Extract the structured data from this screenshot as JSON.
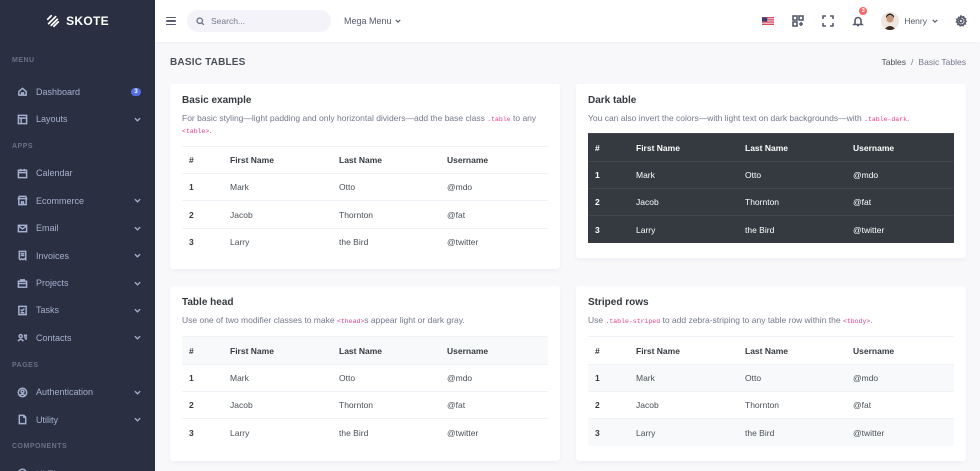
{
  "brand": {
    "name": "SKOTE"
  },
  "sidebar": {
    "sections": [
      {
        "title": "MENU",
        "items": [
          {
            "label": "Dashboard",
            "icon": "home-icon",
            "badge": "3"
          },
          {
            "label": "Layouts",
            "icon": "layout-icon",
            "chevron": true
          }
        ]
      },
      {
        "title": "APPS",
        "items": [
          {
            "label": "Calendar",
            "icon": "calendar-icon"
          },
          {
            "label": "Ecommerce",
            "icon": "store-icon",
            "chevron": true
          },
          {
            "label": "Email",
            "icon": "envelope-icon",
            "chevron": true
          },
          {
            "label": "Invoices",
            "icon": "receipt-icon",
            "chevron": true
          },
          {
            "label": "Projects",
            "icon": "briefcase-icon",
            "chevron": true
          },
          {
            "label": "Tasks",
            "icon": "task-icon",
            "chevron": true
          },
          {
            "label": "Contacts",
            "icon": "contacts-icon",
            "chevron": true
          }
        ]
      },
      {
        "title": "PAGES",
        "items": [
          {
            "label": "Authentication",
            "icon": "user-circle-icon",
            "chevron": true
          },
          {
            "label": "Utility",
            "icon": "file-icon",
            "chevron": true
          }
        ]
      },
      {
        "title": "COMPONENTS",
        "items": [
          {
            "label": "UI Elements",
            "icon": "tune-icon",
            "chevron": true
          }
        ]
      }
    ]
  },
  "topbar": {
    "search_placeholder": "Search...",
    "mega_menu_label": "Mega Menu",
    "notification_count": "3",
    "user_name": "Henry"
  },
  "page": {
    "title": "BASIC TABLES",
    "breadcrumb": [
      "Tables",
      "Basic Tables"
    ]
  },
  "table_columns": [
    "#",
    "First Name",
    "Last Name",
    "Username"
  ],
  "table_rows": [
    [
      "1",
      "Mark",
      "Otto",
      "@mdo"
    ],
    [
      "2",
      "Jacob",
      "Thornton",
      "@fat"
    ],
    [
      "3",
      "Larry",
      "the Bird",
      "@twitter"
    ]
  ],
  "cards": {
    "basic": {
      "title": "Basic example",
      "desc_pre": "For basic styling—light padding and only horizontal dividers—add the base class ",
      "desc_code1": ".table",
      "desc_mid": " to any ",
      "desc_code2": "<table>",
      "desc_post": "."
    },
    "dark": {
      "title": "Dark table",
      "desc_pre": "You can also invert the colors—with light text on dark backgrounds—with ",
      "desc_code1": ".table-dark",
      "desc_post": "."
    },
    "head": {
      "title": "Table head",
      "desc_pre": "Use one of two modifier classes to make ",
      "desc_code1": "<thead>",
      "desc_post": "s appear light or dark gray."
    },
    "striped": {
      "title": "Striped rows",
      "desc_pre": "Use ",
      "desc_code1": ".table-striped",
      "desc_mid": " to add zebra-striping to any table row within the ",
      "desc_code2": "<tbody>",
      "desc_post": "."
    }
  },
  "colors": {
    "sidebar_bg": "#2a3042",
    "accent": "#556ee6",
    "danger": "#f46a6a",
    "dark_table_bg": "#343a40"
  }
}
